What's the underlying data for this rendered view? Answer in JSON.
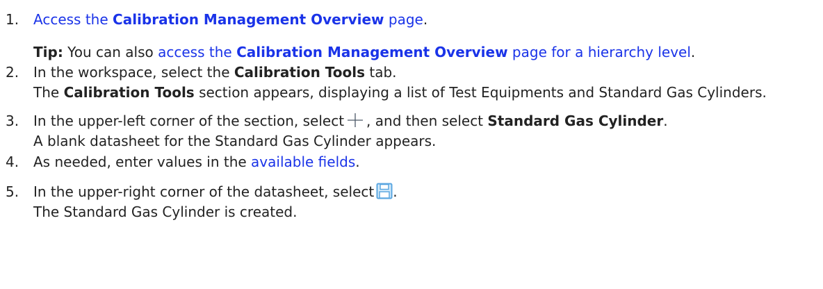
{
  "steps": [
    {
      "number": "1.",
      "pre": "",
      "link_pre": "Access the ",
      "link_bold": "Calibration Management Overview",
      "link_post": " page",
      "post": ".",
      "tip": {
        "label": "Tip:",
        "text": " You can also ",
        "link_pre": "access the ",
        "link_bold": "Calibration Management Overview",
        "link_post": " page for a hierarchy level",
        "post": "."
      }
    },
    {
      "number": "2.",
      "pre": "In the workspace, select the ",
      "bold": "Calibration Tools",
      "post": " tab.",
      "result_pre": "The ",
      "result_bold": "Calibration Tools",
      "result_post": " section appears, displaying a list of Test Equipments and Standard Gas Cylinders."
    },
    {
      "number": "3.",
      "pre": "In the upper-left corner of the section, select",
      "icon": "plus-icon",
      "mid": ", and then select ",
      "bold": "Standard Gas Cylinder",
      "post": ".",
      "result": "A blank datasheet for the Standard Gas Cylinder appears."
    },
    {
      "number": "4.",
      "pre": "As needed, enter values in the ",
      "link": "available fields",
      "post": "."
    },
    {
      "number": "5.",
      "pre": "In the upper-right corner of the datasheet, select",
      "icon": "save-icon",
      "post": ".",
      "result": "The Standard Gas Cylinder is created."
    }
  ],
  "colors": {
    "link": "#1a33e8",
    "text": "#222222",
    "save_icon_border": "#5aa6e0",
    "save_icon_fill": "#d6ecfb"
  }
}
